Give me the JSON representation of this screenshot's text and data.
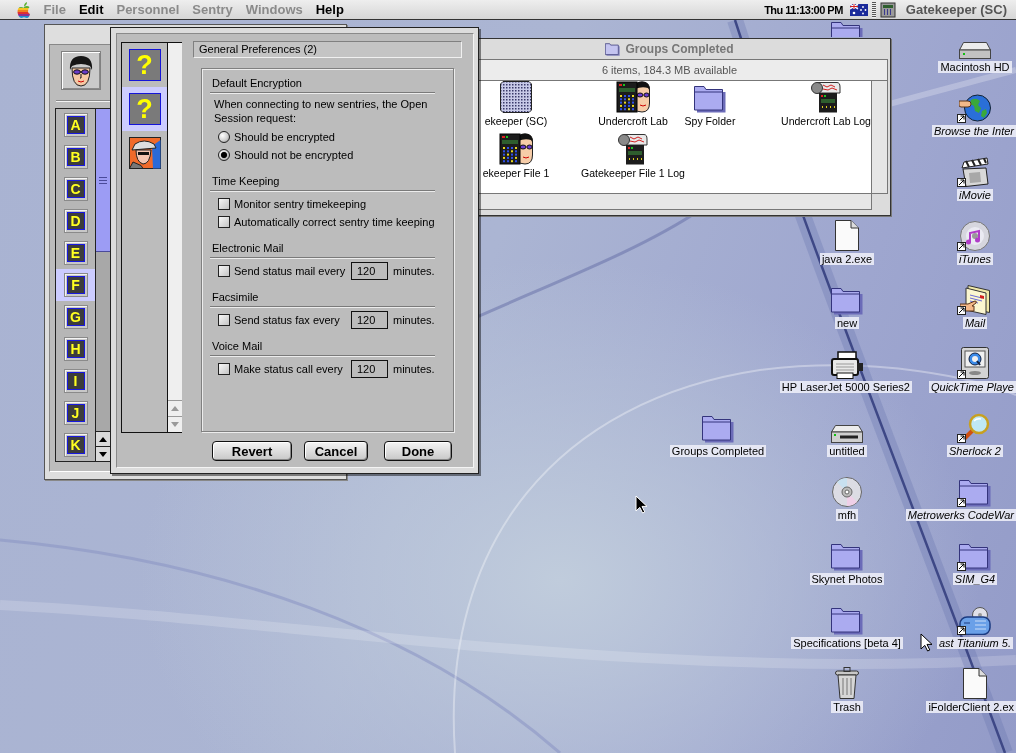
{
  "menu_bar": {
    "menus": [
      {
        "label": "File",
        "disabled": true
      },
      {
        "label": "Edit",
        "disabled": false
      },
      {
        "label": "Personnel",
        "disabled": true
      },
      {
        "label": "Sentry",
        "disabled": true
      },
      {
        "label": "Windows",
        "disabled": true
      },
      {
        "label": "Help",
        "disabled": false
      }
    ],
    "clock": "Thu 11:13:00 PM",
    "app_name": "Gatekeeper (SC)"
  },
  "personnel_window": {
    "letters": [
      {
        "label": "A",
        "selected": false
      },
      {
        "label": "B",
        "selected": false
      },
      {
        "label": "C",
        "selected": false
      },
      {
        "label": "D",
        "selected": false
      },
      {
        "label": "E",
        "selected": false
      },
      {
        "label": "F",
        "selected": true
      },
      {
        "label": "G",
        "selected": false
      },
      {
        "label": "H",
        "selected": false
      },
      {
        "label": "I",
        "selected": false
      },
      {
        "label": "J",
        "selected": false
      },
      {
        "label": "K",
        "selected": false
      }
    ]
  },
  "preferences_window": {
    "categories": [
      {
        "kind": "glyph",
        "glyph": "?",
        "selected": false
      },
      {
        "kind": "glyph",
        "glyph": "?",
        "selected": true
      },
      {
        "kind": "spy",
        "selected": false
      }
    ],
    "panel_title": "General Preferences (2)",
    "sections": [
      {
        "heading": "Default Encryption",
        "text": "When connecting to new sentries, the Open Session request:",
        "options": [
          {
            "kind": "radio",
            "label": "Should be encrypted",
            "selected": false
          },
          {
            "kind": "radio",
            "label": "Should not be encrypted",
            "selected": true
          }
        ]
      },
      {
        "heading": "Time Keeping",
        "options": [
          {
            "kind": "checkbox",
            "label": "Monitor sentry timekeeping",
            "checked": false
          },
          {
            "kind": "checkbox",
            "label": "Automatically correct sentry time keeping",
            "checked": false
          }
        ]
      },
      {
        "heading": "Electronic Mail",
        "options": [
          {
            "kind": "interval",
            "label": "Send status mail every",
            "checked": false,
            "value": "120",
            "unit": "minutes."
          }
        ]
      },
      {
        "heading": "Facsimile",
        "options": [
          {
            "kind": "interval",
            "label": "Send status fax every",
            "checked": false,
            "value": "120",
            "unit": "minutes."
          }
        ]
      },
      {
        "heading": "Voice Mail",
        "options": [
          {
            "kind": "interval",
            "label": "Make status call every",
            "checked": false,
            "value": "120",
            "unit": "minutes."
          }
        ]
      }
    ],
    "buttons": [
      "Revert",
      "Cancel",
      "Done"
    ]
  },
  "finder_window": {
    "title": "Groups Completed",
    "info": "6 items, 184.3 MB available",
    "items": [
      {
        "label": "ekeeper (SC)",
        "kind": "disk-image"
      },
      {
        "label": "Undercroft Lab",
        "kind": "sentry"
      },
      {
        "label": "Spy Folder",
        "kind": "folder"
      },
      {
        "label": "Undercroft Lab Log",
        "kind": "log"
      },
      {
        "label": "ekeeper File 1",
        "kind": "sentry"
      },
      {
        "label": "Gatekeeper File 1 Log",
        "kind": "log"
      }
    ]
  },
  "desktop": {
    "icons": [
      {
        "kind": "folder"
      },
      {
        "label": "Macintosh HD",
        "kind": "hard-disk",
        "alias": false
      },
      {
        "label": "Browse the Inter",
        "kind": "globe",
        "alias": true
      },
      {
        "label": "iMovie",
        "kind": "movie",
        "alias": true
      },
      {
        "label": "java 2.exe",
        "kind": "document",
        "alias": false
      },
      {
        "label": "iTunes",
        "kind": "music",
        "alias": true
      },
      {
        "label": "new",
        "kind": "folder",
        "alias": false
      },
      {
        "label": "Mail",
        "kind": "mail",
        "alias": true
      },
      {
        "label": "HP LaserJet 5000 Series2",
        "kind": "printer",
        "alias": false
      },
      {
        "label": "QuickTime Playe",
        "kind": "quicktime",
        "alias": true
      },
      {
        "label": "Groups Completed",
        "kind": "folder",
        "alias": false
      },
      {
        "label": "untitled",
        "kind": "drive",
        "alias": false
      },
      {
        "label": "Sherlock 2",
        "kind": "magnifier",
        "alias": true
      },
      {
        "label": "mfh",
        "kind": "cd",
        "alias": false
      },
      {
        "label": "Metrowerks CodeWar",
        "kind": "folder",
        "alias": true
      },
      {
        "label": "Skynet Photos",
        "kind": "folder",
        "alias": false
      },
      {
        "label": "SIM_G4",
        "kind": "folder",
        "alias": true
      },
      {
        "label": "Specifications [beta 4]",
        "kind": "folder",
        "alias": false
      },
      {
        "label": "ast Titanium 5.",
        "kind": "toaster",
        "alias": true
      },
      {
        "label": "Trash",
        "kind": "trash",
        "alias": false
      },
      {
        "label": "iFolderClient 2.ex",
        "kind": "document",
        "alias": false
      }
    ]
  }
}
